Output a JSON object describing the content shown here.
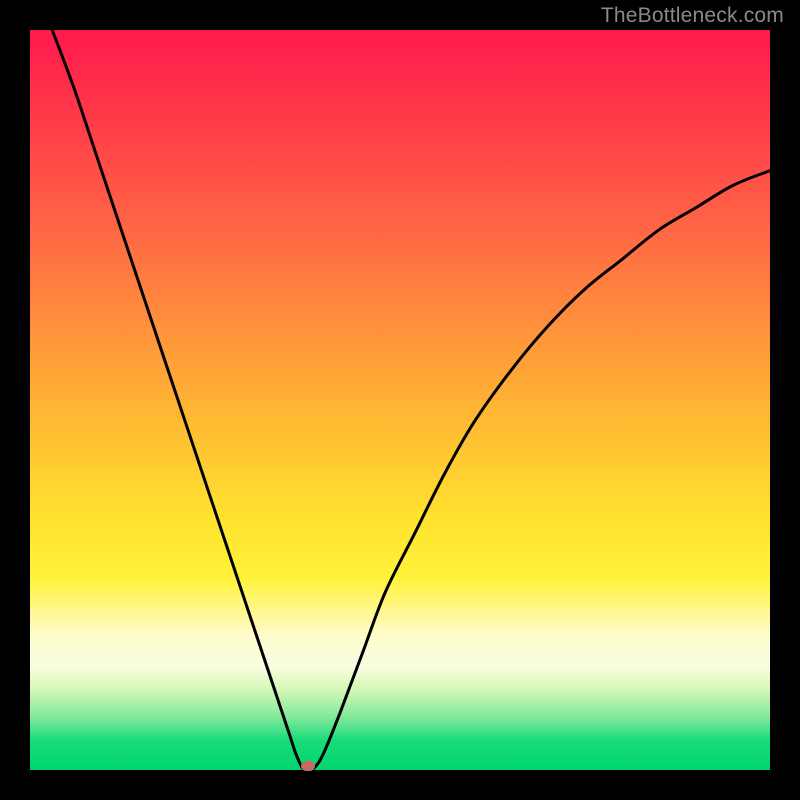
{
  "watermark": "TheBottleneck.com",
  "colors": {
    "frame": "#000000",
    "curve": "#000000",
    "marker": "#c46b64"
  },
  "chart_data": {
    "type": "line",
    "title": "",
    "xlabel": "",
    "ylabel": "",
    "xlim": [
      0,
      100
    ],
    "ylim": [
      0,
      100
    ],
    "grid": false,
    "legend": false,
    "optimum_x": 37,
    "marker": {
      "x": 37.5,
      "y": 0.5
    },
    "series": [
      {
        "name": "bottleneck-curve",
        "x": [
          3,
          6,
          9,
          12,
          15,
          18,
          21,
          24,
          27,
          30,
          33,
          35,
          36,
          37,
          38,
          39,
          40,
          42,
          45,
          48,
          52,
          56,
          60,
          65,
          70,
          75,
          80,
          85,
          90,
          95,
          100
        ],
        "y": [
          100,
          92,
          83,
          74,
          65,
          56,
          47,
          38,
          29,
          20,
          11,
          5,
          2,
          0,
          0,
          1,
          3,
          8,
          16,
          24,
          32,
          40,
          47,
          54,
          60,
          65,
          69,
          73,
          76,
          79,
          81
        ]
      }
    ],
    "background_gradient": {
      "stops": [
        {
          "pos": 0.0,
          "color": "#ff1a4d"
        },
        {
          "pos": 0.08,
          "color": "#ff2f4a"
        },
        {
          "pos": 0.22,
          "color": "#ff5747"
        },
        {
          "pos": 0.38,
          "color": "#ff8a3d"
        },
        {
          "pos": 0.52,
          "color": "#ffb733"
        },
        {
          "pos": 0.66,
          "color": "#ffe22e"
        },
        {
          "pos": 0.74,
          "color": "#fff23a"
        },
        {
          "pos": 0.82,
          "color": "#fffccf"
        },
        {
          "pos": 0.86,
          "color": "#f8fde0"
        },
        {
          "pos": 0.89,
          "color": "#d8f8b8"
        },
        {
          "pos": 0.93,
          "color": "#7de89a"
        },
        {
          "pos": 0.96,
          "color": "#19db7a"
        },
        {
          "pos": 1.0,
          "color": "#00d66f"
        }
      ]
    }
  }
}
